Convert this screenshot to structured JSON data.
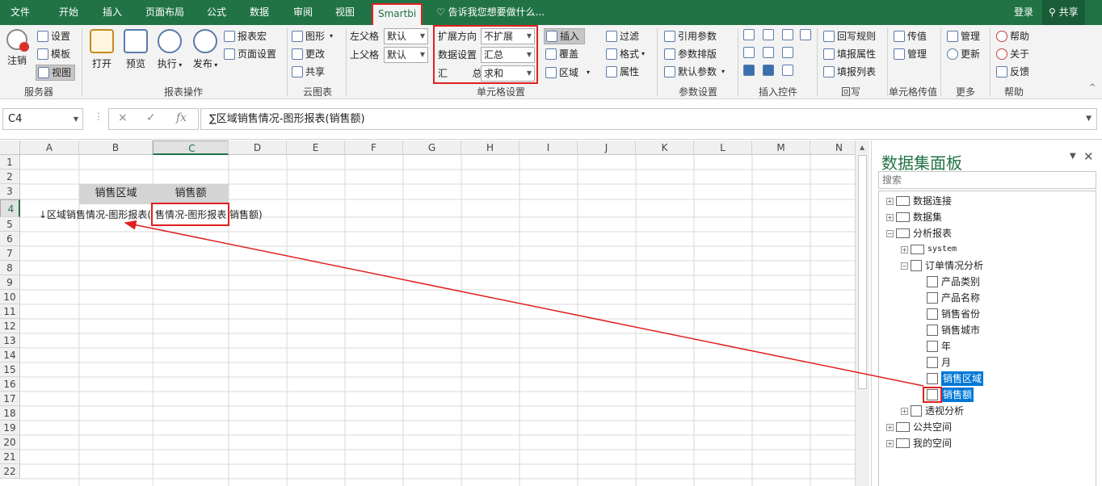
{
  "menu": {
    "file": "文件",
    "home": "开始",
    "insert": "插入",
    "page_layout": "页面布局",
    "formulas": "公式",
    "data": "数据",
    "review": "审阅",
    "view": "视图",
    "smartbi": "Smartbi",
    "tell_me": "告诉我您想要做什么...",
    "login": "登录",
    "share": "共享"
  },
  "ribbon": {
    "server": {
      "logout": "注销",
      "settings": "设置",
      "template": "模板",
      "view": "视图",
      "label": "服务器"
    },
    "report_ops": {
      "open": "打开",
      "preview": "预览",
      "execute": "执行",
      "publish": "发布",
      "report_macro": "报表宏",
      "page_setup": "页面设置",
      "label": "报表操作"
    },
    "cloud_chart": {
      "chart": "图形",
      "update": "更改",
      "share": "共享",
      "label": "云图表"
    },
    "parent": {
      "left_label": "左父格",
      "left_value": "默认",
      "top_label": "上父格",
      "top_value": "默认"
    },
    "cell_settings": {
      "expand_label": "扩展方向",
      "expand_value": "不扩展",
      "data_label": "数据设置",
      "data_value": "汇总",
      "agg_label": "汇        总",
      "agg_value": "求和",
      "insert": "插入",
      "cover": "覆盖",
      "area": "区域",
      "filter": "过滤",
      "format": "格式",
      "property": "属性",
      "label": "单元格设置"
    },
    "params": {
      "ref_param": "引用参数",
      "param_layout": "参数排版",
      "default_param": "默认参数",
      "label": "参数设置"
    },
    "insert_ctrl": {
      "label": "插入控件"
    },
    "writeback": {
      "rule": "回写规则",
      "fill_prop": "填报属性",
      "fill_list": "填报列表",
      "label": "回写"
    },
    "cell_pass": {
      "pass_value": "传值",
      "manage": "管理",
      "label": "单元格传值"
    },
    "more": {
      "manage": "管理",
      "update": "更新",
      "label": "更多"
    },
    "help": {
      "help": "帮助",
      "about": "关于",
      "feedback": "反馈",
      "label": "帮助"
    }
  },
  "formula_bar": {
    "name_box": "C4",
    "cancel_icon": "×",
    "enter_icon": "✓",
    "fx": "fx",
    "content": "∑区域销售情况-图形报表(销售额)"
  },
  "sheet": {
    "columns": [
      "A",
      "B",
      "C",
      "D",
      "E",
      "F",
      "G",
      "H",
      "I",
      "J",
      "K",
      "L",
      "M",
      "N"
    ],
    "rows": [
      "1",
      "2",
      "3",
      "4",
      "5",
      "6",
      "7",
      "8",
      "9",
      "10",
      "11",
      "12",
      "13",
      "14",
      "15",
      "16",
      "17",
      "18",
      "19",
      "20",
      "21",
      "22"
    ],
    "b3": "销售区域",
    "c3": "销售额",
    "row4_text": "↓区域销售情况-图形报表(",
    "c4_text": "售情况-图形报表",
    "d4_text": "销售额)"
  },
  "panel": {
    "title": "数据集面板",
    "search_placeholder": "搜索",
    "tree": {
      "data_conn": "数据连接",
      "dataset": "数据集",
      "analysis_report": "分析报表",
      "system": "system",
      "order_analysis": "订单情况分析",
      "product_category": "产品类别",
      "product_name": "产品名称",
      "sales_province": "销售省份",
      "sales_city": "销售城市",
      "year": "年",
      "month": "月",
      "sales_region": "销售区域",
      "sales_amount": "销售额",
      "pivot_analysis": "透视分析",
      "public_space": "公共空间",
      "my_space": "我的空间"
    }
  }
}
